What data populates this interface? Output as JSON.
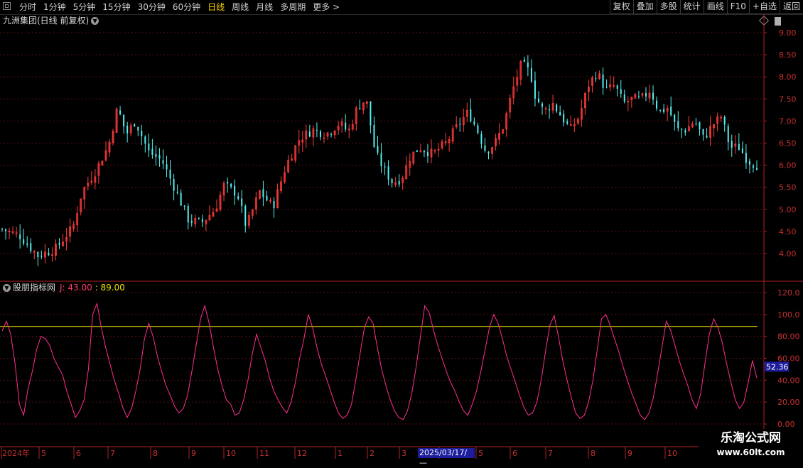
{
  "toolbar": {
    "periods": [
      "分时",
      "1分钟",
      "5分钟",
      "15分钟",
      "30分钟",
      "60分钟",
      "日线",
      "周线",
      "月线",
      "多周期",
      "更多 >"
    ],
    "active_period": "日线",
    "right_buttons": [
      "复权",
      "叠加",
      "多股",
      "统计",
      "画线",
      "F10",
      "+自选",
      "返回"
    ]
  },
  "main_chart": {
    "title": "九洲集团(日线 前复权)",
    "y_ticks": [
      "9.00",
      "8.50",
      "8.00",
      "7.50",
      "7.00",
      "6.50",
      "6.00",
      "5.50",
      "5.00",
      "4.50",
      "4.00"
    ],
    "up_color": "#ff3b3b",
    "down_color": "#54f0f0"
  },
  "indicator": {
    "name": "股朋指标网",
    "j_label": "J: 43.00",
    "line_label": ": 89.00",
    "line_value": 89,
    "current_value": "52.36",
    "y_ticks": [
      "120.0",
      "100.0",
      "80.00",
      "60.00",
      "40.00",
      "20.00",
      "0.00"
    ],
    "j_color": "#ff2f8f",
    "line_color": "#e8e000"
  },
  "x_axis": {
    "labels": [
      "2024年",
      "5",
      "6",
      "7",
      "8",
      "9",
      "10",
      "11",
      "12",
      "1",
      "2",
      "3",
      "4",
      "5",
      "6",
      "7",
      "8",
      "9",
      "10"
    ],
    "highlight_date": "2025/03/17/—"
  },
  "watermark": {
    "line1": "乐淘公式网",
    "line2": "www.60lt.com"
  },
  "chart_data": [
    {
      "type": "candlestick",
      "title": "九洲集团(日线 前复权)",
      "ylim": [
        3.6,
        9.1
      ],
      "x": [
        "2024-04",
        "2024-05",
        "2024-06",
        "2024-07",
        "2024-08",
        "2024-09",
        "2024-10",
        "2024-11",
        "2024-12",
        "2025-01",
        "2025-02",
        "2025-03",
        "2025-04",
        "2025-05",
        "2025-06",
        "2025-07",
        "2025-08",
        "2025-09",
        "2025-10"
      ],
      "close_path": [
        [
          0,
          4.55
        ],
        [
          4,
          4.4
        ],
        [
          8,
          3.95
        ],
        [
          12,
          4.1
        ],
        [
          16,
          4.6
        ],
        [
          18,
          5.4
        ],
        [
          21,
          5.85
        ],
        [
          24,
          6.45
        ],
        [
          26,
          7.3
        ],
        [
          28,
          6.7
        ],
        [
          30,
          7.0
        ],
        [
          33,
          6.3
        ],
        [
          36,
          6.1
        ],
        [
          39,
          5.45
        ],
        [
          42,
          4.75
        ],
        [
          45,
          4.7
        ],
        [
          48,
          5.0
        ],
        [
          50,
          5.55
        ],
        [
          53,
          5.35
        ],
        [
          55,
          4.6
        ],
        [
          58,
          5.4
        ],
        [
          61,
          5.05
        ],
        [
          64,
          6.0
        ],
        [
          67,
          6.6
        ],
        [
          70,
          6.8
        ],
        [
          73,
          6.7
        ],
        [
          76,
          6.95
        ],
        [
          78,
          6.75
        ],
        [
          80,
          7.3
        ],
        [
          82,
          7.5
        ],
        [
          84,
          6.3
        ],
        [
          86,
          5.9
        ],
        [
          88,
          5.6
        ],
        [
          90,
          5.7
        ],
        [
          92,
          6.2
        ],
        [
          94,
          6.4
        ],
        [
          97,
          6.25
        ],
        [
          100,
          6.5
        ],
        [
          103,
          6.95
        ],
        [
          105,
          7.2
        ],
        [
          107,
          6.8
        ],
        [
          109,
          6.3
        ],
        [
          111,
          6.5
        ],
        [
          113,
          6.9
        ],
        [
          115,
          7.7
        ],
        [
          117,
          8.3
        ],
        [
          119,
          8.1
        ],
        [
          120,
          7.6
        ],
        [
          122,
          7.2
        ],
        [
          124,
          7.4
        ],
        [
          126,
          7.1
        ],
        [
          128,
          6.8
        ],
        [
          130,
          7.1
        ],
        [
          132,
          7.8
        ],
        [
          134,
          8.1
        ],
        [
          136,
          7.7
        ],
        [
          138,
          7.8
        ],
        [
          140,
          7.4
        ],
        [
          142,
          7.5
        ],
        [
          144,
          7.5
        ],
        [
          146,
          7.7
        ],
        [
          148,
          7.2
        ],
        [
          150,
          7.3
        ],
        [
          152,
          6.8
        ],
        [
          154,
          6.8
        ],
        [
          156,
          7.0
        ],
        [
          158,
          6.6
        ],
        [
          160,
          6.9
        ],
        [
          162,
          7.1
        ],
        [
          164,
          6.4
        ],
        [
          166,
          6.4
        ],
        [
          168,
          6.1
        ],
        [
          170,
          6.0
        ]
      ]
    },
    {
      "type": "line",
      "series": [
        {
          "name": "J",
          "values": [
            85,
            94,
            82,
            55,
            18,
            8,
            32,
            48,
            68,
            80,
            78,
            72,
            60,
            52,
            45,
            30,
            18,
            6,
            12,
            22,
            50,
            100,
            110,
            88,
            70,
            55,
            40,
            28,
            15,
            6,
            14,
            30,
            50,
            78,
            92,
            80,
            62,
            48,
            35,
            26,
            16,
            10,
            14,
            26,
            48,
            72,
            96,
            108,
            92,
            70,
            50,
            35,
            22,
            18,
            8,
            10,
            22,
            40,
            64,
            82,
            70,
            58,
            42,
            30,
            22,
            15,
            10,
            20,
            38,
            60,
            78,
            100,
            88,
            70,
            55,
            44,
            32,
            20,
            10,
            5,
            8,
            18,
            40,
            64,
            88,
            98,
            92,
            70,
            50,
            35,
            22,
            12,
            6,
            4,
            12,
            28,
            52,
            80,
            108,
            102,
            86,
            72,
            60,
            48,
            38,
            30,
            20,
            12,
            8,
            18,
            30,
            48,
            68,
            88,
            100,
            92,
            78,
            62,
            50,
            38,
            26,
            15,
            8,
            10,
            20,
            40,
            66,
            90,
            99,
            80,
            58,
            40,
            24,
            10,
            5,
            8,
            20,
            40,
            68,
            96,
            100,
            90,
            78,
            66,
            52,
            40,
            28,
            18,
            8,
            4,
            10,
            24,
            46,
            70,
            94,
            86,
            72,
            58,
            46,
            35,
            22,
            14,
            28,
            56,
            82,
            96,
            88,
            74,
            55,
            38,
            22,
            14,
            20,
            38,
            58,
            42
          ]
        },
        {
          "name": "Line",
          "values": [
            89
          ]
        }
      ],
      "ylim": [
        0,
        120
      ],
      "current_value": 52.36
    }
  ]
}
